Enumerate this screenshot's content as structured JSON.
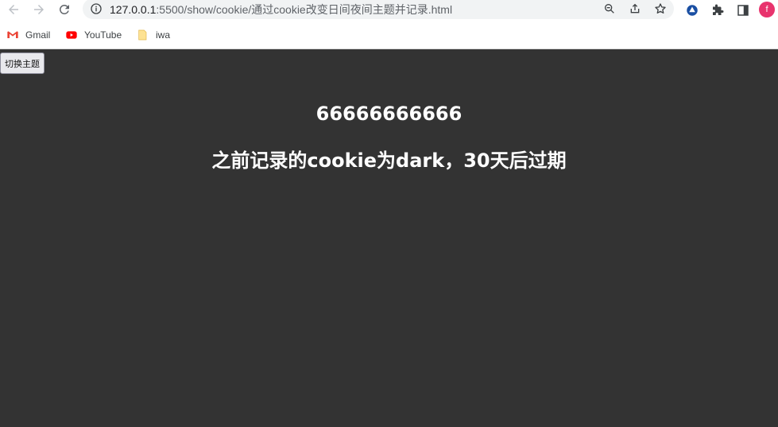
{
  "browser": {
    "url_host": "127.0.0.1",
    "url_path": ":5500/show/cookie/通过cookie改变日间夜间主题并记录.html",
    "avatar_letter": "f",
    "bookmarks": [
      {
        "label": "Gmail",
        "icon": "gmail-icon"
      },
      {
        "label": "YouTube",
        "icon": "youtube-icon"
      },
      {
        "label": "iwa",
        "icon": "folder-icon"
      }
    ]
  },
  "page": {
    "background_color": "#333333",
    "text_color": "#ffffff",
    "theme_button_label": "切换主题",
    "heading_1": "66666666666",
    "heading_2": "之前记录的cookie为dark，30天后过期"
  }
}
